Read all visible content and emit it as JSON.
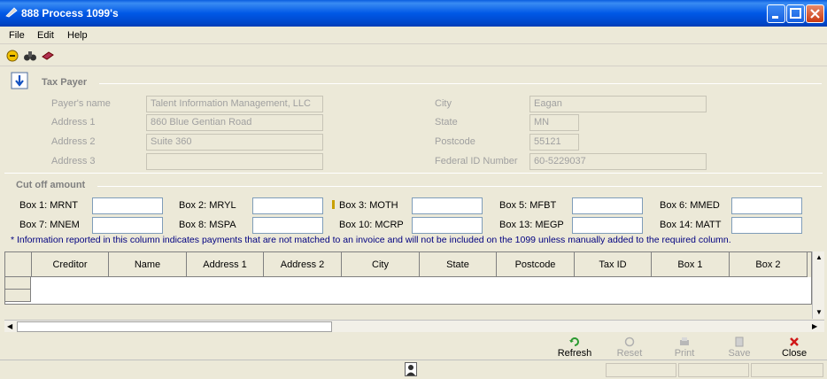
{
  "window": {
    "title": "888  Process 1099's",
    "icon": "pen-icon"
  },
  "menu": [
    {
      "label": "File"
    },
    {
      "label": "Edit"
    },
    {
      "label": "Help"
    }
  ],
  "toolbar": {
    "icons": [
      "coin-icon",
      "binoculars-icon",
      "book-icon"
    ]
  },
  "tax_payer": {
    "title": "Tax Payer",
    "payers_name_label": "Payer's name",
    "payers_name": "Talent Information Management, LLC",
    "address1_label": "Address 1",
    "address1": "860 Blue Gentian Road",
    "address2_label": "Address 2",
    "address2": "Suite 360",
    "address3_label": "Address 3",
    "address3": "",
    "city_label": "City",
    "city": "Eagan",
    "state_label": "State",
    "state": "MN",
    "postcode_label": "Postcode",
    "postcode": "55121",
    "federal_id_label": "Federal ID Number",
    "federal_id": "60-5229037"
  },
  "cutoff": {
    "title": "Cut off amount",
    "boxes": [
      {
        "label": "Box 1: MRNT",
        "value": ""
      },
      {
        "label": "Box 2: MRYL",
        "value": ""
      },
      {
        "label": "Box 3: MOTH",
        "value": ""
      },
      {
        "label": "Box 5: MFBT",
        "value": ""
      },
      {
        "label": "Box 6: MMED",
        "value": ""
      },
      {
        "label": "Box 7: MNEM",
        "value": ""
      },
      {
        "label": "Box 8: MSPA",
        "value": ""
      },
      {
        "label": "Box 10: MCRP",
        "value": ""
      },
      {
        "label": "Box 13: MEGP",
        "value": ""
      },
      {
        "label": "Box 14: MATT",
        "value": ""
      }
    ],
    "note": "* Information reported in this column indicates payments that are not matched to an invoice and will not be included on the 1099 unless manually added to the required column."
  },
  "grid": {
    "columns": [
      "Creditor",
      "Name",
      "Address 1",
      "Address 2",
      "City",
      "State",
      "Postcode",
      "Tax ID",
      "Box 1",
      "Box 2"
    ]
  },
  "actions": [
    {
      "label": "Refresh",
      "icon": "refresh-icon",
      "enabled": true
    },
    {
      "label": "Reset",
      "icon": "reset-icon",
      "enabled": false
    },
    {
      "label": "Print",
      "icon": "print-icon",
      "enabled": false
    },
    {
      "label": "Save",
      "icon": "save-icon",
      "enabled": false
    },
    {
      "label": "Close",
      "icon": "close-x-icon",
      "enabled": true
    }
  ]
}
